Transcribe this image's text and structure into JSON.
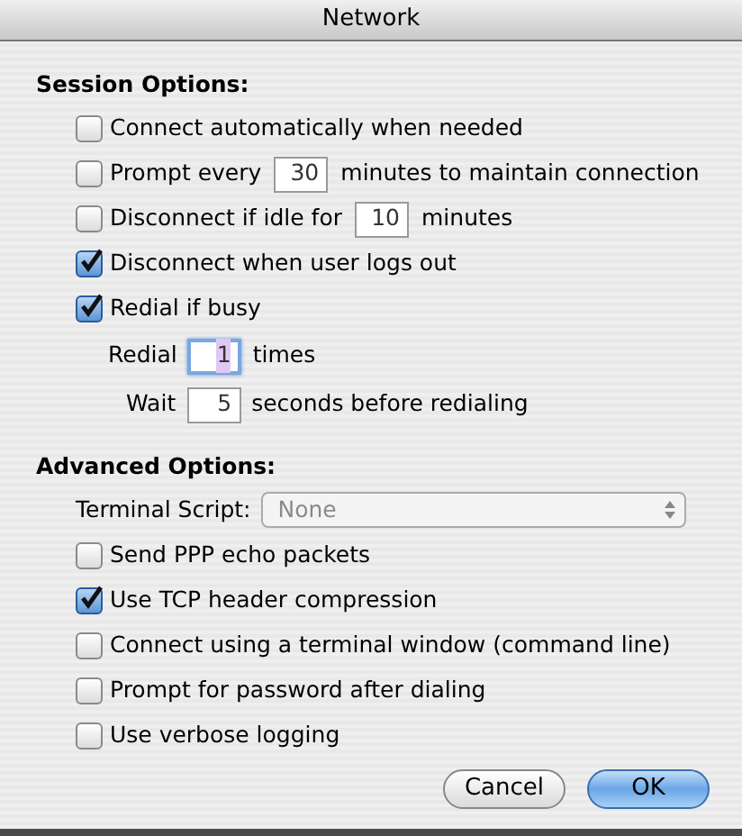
{
  "window": {
    "title": "Network"
  },
  "session": {
    "heading": "Session Options:",
    "items": [
      {
        "kind": "checkbox",
        "checked": false,
        "label": "Connect automatically when needed"
      },
      {
        "kind": "checkbox_field",
        "checked": false,
        "label": "Prompt every",
        "value": "30",
        "suffix": "minutes to maintain connection"
      },
      {
        "kind": "checkbox_field",
        "checked": false,
        "label": "Disconnect if idle for",
        "value": "10",
        "suffix": "minutes"
      },
      {
        "kind": "checkbox",
        "checked": true,
        "label": "Disconnect when user logs out"
      },
      {
        "kind": "checkbox",
        "checked": true,
        "label": "Redial if busy"
      },
      {
        "kind": "field",
        "focused": true,
        "label": "Redial",
        "value": "1",
        "suffix": "times"
      },
      {
        "kind": "field",
        "focused": false,
        "label": "Wait",
        "value": "5",
        "suffix": "seconds before redialing"
      }
    ]
  },
  "advanced": {
    "heading": "Advanced Options:",
    "terminal_script": {
      "label": "Terminal Script:",
      "value": "None"
    },
    "items": [
      {
        "kind": "checkbox",
        "checked": false,
        "label": "Send PPP echo packets"
      },
      {
        "kind": "checkbox",
        "checked": true,
        "label": "Use TCP header compression"
      },
      {
        "kind": "checkbox",
        "checked": false,
        "label": "Connect using a terminal window (command line)"
      },
      {
        "kind": "checkbox",
        "checked": false,
        "label": "Prompt for password after dialing"
      },
      {
        "kind": "checkbox",
        "checked": false,
        "label": "Use verbose logging"
      }
    ]
  },
  "buttons": [
    {
      "label": "Cancel",
      "default": false
    },
    {
      "label": "OK",
      "default": true
    }
  ]
}
